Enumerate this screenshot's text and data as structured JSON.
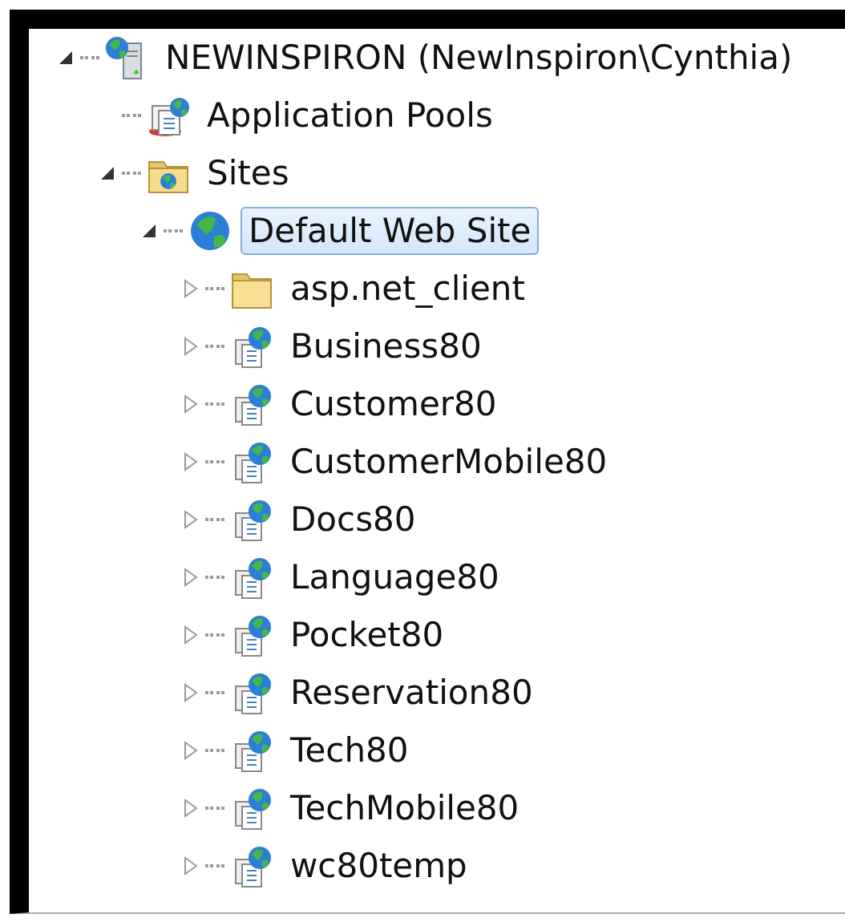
{
  "tree": [
    {
      "label": "NEWINSPIRON (NewInspiron\\Cynthia)",
      "kind": "server",
      "expandable": true,
      "expanded": true,
      "selected": false,
      "children": [
        {
          "label": "Application Pools",
          "kind": "app-pools",
          "expandable": false,
          "selected": false
        },
        {
          "label": "Sites",
          "kind": "sites",
          "expandable": true,
          "expanded": true,
          "selected": false,
          "children": [
            {
              "label": "Default Web Site",
              "kind": "globe",
              "expandable": true,
              "expanded": true,
              "selected": true,
              "children": [
                {
                  "label": "asp.net_client",
                  "kind": "folder",
                  "expandable": true,
                  "expanded": false,
                  "selected": false
                },
                {
                  "label": "Business80",
                  "kind": "site",
                  "expandable": true,
                  "expanded": false,
                  "selected": false
                },
                {
                  "label": "Customer80",
                  "kind": "site",
                  "expandable": true,
                  "expanded": false,
                  "selected": false
                },
                {
                  "label": "CustomerMobile80",
                  "kind": "site",
                  "expandable": true,
                  "expanded": false,
                  "selected": false
                },
                {
                  "label": "Docs80",
                  "kind": "site",
                  "expandable": true,
                  "expanded": false,
                  "selected": false
                },
                {
                  "label": "Language80",
                  "kind": "site",
                  "expandable": true,
                  "expanded": false,
                  "selected": false
                },
                {
                  "label": "Pocket80",
                  "kind": "site",
                  "expandable": true,
                  "expanded": false,
                  "selected": false
                },
                {
                  "label": "Reservation80",
                  "kind": "site",
                  "expandable": true,
                  "expanded": false,
                  "selected": false
                },
                {
                  "label": "Tech80",
                  "kind": "site",
                  "expandable": true,
                  "expanded": false,
                  "selected": false
                },
                {
                  "label": "TechMobile80",
                  "kind": "site",
                  "expandable": true,
                  "expanded": false,
                  "selected": false
                },
                {
                  "label": "wc80temp",
                  "kind": "site",
                  "expandable": true,
                  "expanded": false,
                  "selected": false
                }
              ]
            }
          ]
        }
      ]
    }
  ]
}
